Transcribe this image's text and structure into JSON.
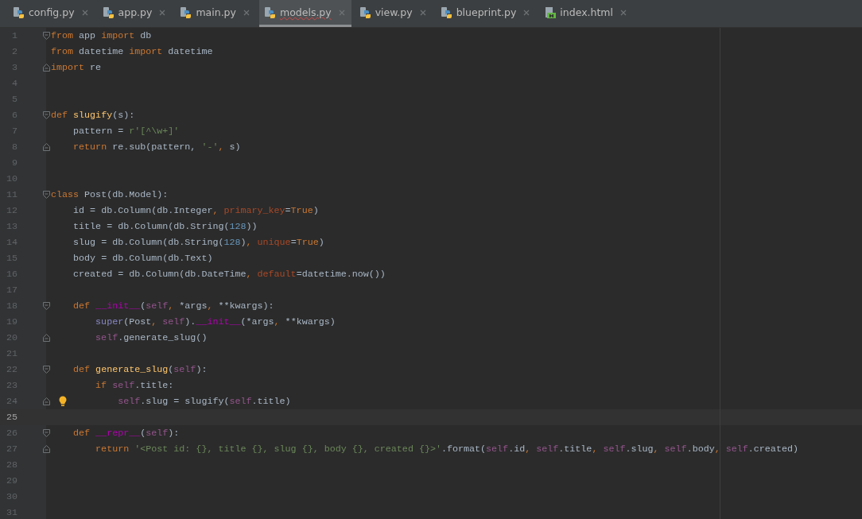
{
  "tabs": [
    {
      "label": "config.py",
      "kind": "python",
      "selected": false
    },
    {
      "label": "app.py",
      "kind": "python",
      "selected": false
    },
    {
      "label": "main.py",
      "kind": "python",
      "selected": false
    },
    {
      "label": "models.py",
      "kind": "python",
      "selected": true
    },
    {
      "label": "view.py",
      "kind": "python",
      "selected": false
    },
    {
      "label": "blueprint.py",
      "kind": "python",
      "selected": false
    },
    {
      "label": "index.html",
      "kind": "html",
      "selected": false
    }
  ],
  "lines": [
    {
      "number": "1",
      "fold_start": true,
      "segments": [
        {
          "kind": "keyword",
          "text": "from"
        },
        {
          "kind": "plain",
          "text": " app "
        },
        {
          "kind": "keyword",
          "text": "import"
        },
        {
          "kind": "plain",
          "text": " db"
        }
      ]
    },
    {
      "number": "2",
      "segments": [
        {
          "kind": "keyword",
          "text": "from"
        },
        {
          "kind": "plain",
          "text": " datetime "
        },
        {
          "kind": "keyword",
          "text": "import"
        },
        {
          "kind": "plain",
          "text": " datetime"
        }
      ]
    },
    {
      "number": "3",
      "fold_end": true,
      "segments": [
        {
          "kind": "keyword",
          "text": "import"
        },
        {
          "kind": "plain",
          "text": " re"
        }
      ]
    },
    {
      "number": "4"
    },
    {
      "number": "5"
    },
    {
      "number": "6",
      "fold_start": true,
      "segments": [
        {
          "kind": "keyword",
          "text": "def"
        },
        {
          "kind": "function",
          "text": " slugify"
        },
        {
          "kind": "plain",
          "text": "(s):"
        }
      ]
    },
    {
      "number": "7",
      "segments": [
        {
          "kind": "plain",
          "text": "    pattern = "
        },
        {
          "kind": "string",
          "text": "r'[^\\w+]'"
        }
      ]
    },
    {
      "number": "8",
      "fold_end": true,
      "segments": [
        {
          "kind": "keyword",
          "text": "    return"
        },
        {
          "kind": "plain",
          "text": " re.sub(pattern, "
        },
        {
          "kind": "string",
          "text": "'-'"
        },
        {
          "kind": "keyword",
          "text": ","
        },
        {
          "kind": "plain",
          "text": " s)"
        }
      ]
    },
    {
      "number": "9"
    },
    {
      "number": "10"
    },
    {
      "number": "11",
      "fold_start": true,
      "segments": [
        {
          "kind": "keyword",
          "text": "class"
        },
        {
          "kind": "plain",
          "text": " Post(db.Model):"
        }
      ]
    },
    {
      "number": "12",
      "segments": [
        {
          "kind": "plain",
          "text": "    id = db.Column(db.Integer"
        },
        {
          "kind": "keyword",
          "text": ", "
        },
        {
          "kind": "param",
          "text": "primary_key"
        },
        {
          "kind": "plain",
          "text": "="
        },
        {
          "kind": "keyword",
          "text": "True"
        },
        {
          "kind": "plain",
          "text": ")"
        }
      ]
    },
    {
      "number": "13",
      "segments": [
        {
          "kind": "plain",
          "text": "    title = db.Column(db.String("
        },
        {
          "kind": "number",
          "text": "128"
        },
        {
          "kind": "plain",
          "text": "))"
        }
      ]
    },
    {
      "number": "14",
      "segments": [
        {
          "kind": "plain",
          "text": "    slug = db.Column(db.String("
        },
        {
          "kind": "number",
          "text": "128"
        },
        {
          "kind": "plain",
          "text": ")"
        },
        {
          "kind": "keyword",
          "text": ", "
        },
        {
          "kind": "param",
          "text": "unique"
        },
        {
          "kind": "plain",
          "text": "="
        },
        {
          "kind": "keyword",
          "text": "True"
        },
        {
          "kind": "plain",
          "text": ")"
        }
      ]
    },
    {
      "number": "15",
      "segments": [
        {
          "kind": "plain",
          "text": "    body = db.Column(db.Text)"
        }
      ]
    },
    {
      "number": "16",
      "segments": [
        {
          "kind": "plain",
          "text": "    created = db.Column(db.DateTime"
        },
        {
          "kind": "keyword",
          "text": ", "
        },
        {
          "kind": "param",
          "text": "default"
        },
        {
          "kind": "plain",
          "text": "=datetime.now())"
        }
      ]
    },
    {
      "number": "17"
    },
    {
      "number": "18",
      "fold_start": true,
      "segments": [
        {
          "kind": "keyword",
          "text": "    def"
        },
        {
          "kind": "magic",
          "text": " __init__"
        },
        {
          "kind": "plain",
          "text": "("
        },
        {
          "kind": "self",
          "text": "self"
        },
        {
          "kind": "keyword",
          "text": ","
        },
        {
          "kind": "plain",
          "text": " *args"
        },
        {
          "kind": "keyword",
          "text": ","
        },
        {
          "kind": "plain",
          "text": " **kwargs):"
        }
      ]
    },
    {
      "number": "19",
      "segments": [
        {
          "kind": "builtin",
          "text": "        super"
        },
        {
          "kind": "plain",
          "text": "(Post"
        },
        {
          "kind": "keyword",
          "text": ","
        },
        {
          "kind": "self",
          "text": " self"
        },
        {
          "kind": "plain",
          "text": ")."
        },
        {
          "kind": "magic",
          "text": "__init__"
        },
        {
          "kind": "plain",
          "text": "(*args"
        },
        {
          "kind": "keyword",
          "text": ","
        },
        {
          "kind": "plain",
          "text": " **kwargs)"
        }
      ]
    },
    {
      "number": "20",
      "fold_end": true,
      "segments": [
        {
          "kind": "self",
          "text": "        self"
        },
        {
          "kind": "plain",
          "text": ".generate_slug()"
        }
      ]
    },
    {
      "number": "21"
    },
    {
      "number": "22",
      "fold_start": true,
      "segments": [
        {
          "kind": "keyword",
          "text": "    def"
        },
        {
          "kind": "function",
          "text": " generate_slug"
        },
        {
          "kind": "plain",
          "text": "("
        },
        {
          "kind": "self",
          "text": "self"
        },
        {
          "kind": "plain",
          "text": "):"
        }
      ]
    },
    {
      "number": "23",
      "segments": [
        {
          "kind": "keyword",
          "text": "        if"
        },
        {
          "kind": "self",
          "text": " self"
        },
        {
          "kind": "plain",
          "text": ".title:"
        }
      ]
    },
    {
      "number": "24",
      "fold_end": true,
      "bulb": true,
      "segments": [
        {
          "kind": "self",
          "text": "            self"
        },
        {
          "kind": "plain",
          "text": ".slug = slugify("
        },
        {
          "kind": "self",
          "text": "self"
        },
        {
          "kind": "plain",
          "text": ".title)"
        }
      ]
    },
    {
      "number": "25",
      "current": true
    },
    {
      "number": "26",
      "fold_start": true,
      "segments": [
        {
          "kind": "keyword",
          "text": "    def"
        },
        {
          "kind": "magic",
          "text": " __repr__"
        },
        {
          "kind": "plain",
          "text": "("
        },
        {
          "kind": "self",
          "text": "self"
        },
        {
          "kind": "plain",
          "text": "):"
        }
      ]
    },
    {
      "number": "27",
      "fold_end": true,
      "segments": [
        {
          "kind": "keyword",
          "text": "        return"
        },
        {
          "kind": "string",
          "text": " '<Post id: {}, title {}, slug {}, body {}, created {}>'"
        },
        {
          "kind": "plain",
          "text": ".format("
        },
        {
          "kind": "self",
          "text": "self"
        },
        {
          "kind": "plain",
          "text": ".id"
        },
        {
          "kind": "keyword",
          "text": ","
        },
        {
          "kind": "self",
          "text": " self"
        },
        {
          "kind": "plain",
          "text": ".title"
        },
        {
          "kind": "keyword",
          "text": ","
        },
        {
          "kind": "self",
          "text": " self"
        },
        {
          "kind": "plain",
          "text": ".slug"
        },
        {
          "kind": "keyword",
          "text": ","
        },
        {
          "kind": "self",
          "text": " self"
        },
        {
          "kind": "plain",
          "text": ".body"
        },
        {
          "kind": "keyword",
          "text": ","
        },
        {
          "kind": "self",
          "text": " self"
        },
        {
          "kind": "plain",
          "text": ".created)"
        }
      ]
    },
    {
      "number": "28"
    },
    {
      "number": "29"
    },
    {
      "number": "30"
    },
    {
      "number": "31"
    }
  ]
}
